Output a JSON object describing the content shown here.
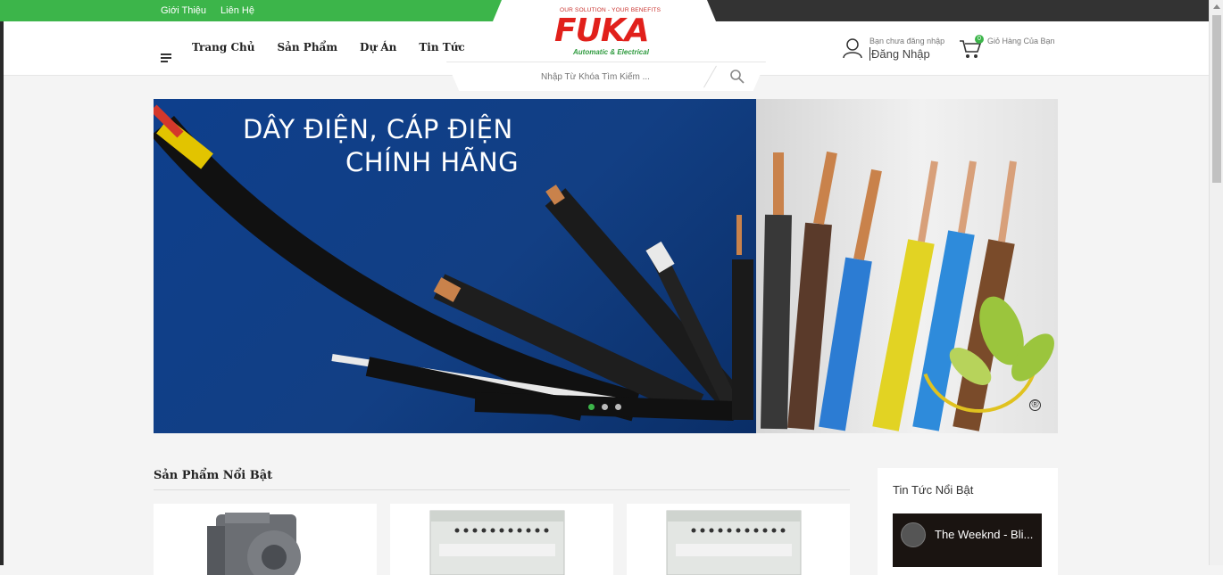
{
  "topbar": {
    "links": [
      "Giới Thiệu",
      "Liên Hệ"
    ]
  },
  "nav": {
    "items": [
      "Trang Chủ",
      "Sản Phẩm",
      "Dự Án",
      "Tin Tức"
    ]
  },
  "logo": {
    "tagline": "OUR SOLUTION - YOUR BENEFITS",
    "word": "FUKA",
    "subtitle": "Automatic & Electrical"
  },
  "search": {
    "placeholder": "Nhập Từ Khóa Tìm Kiếm ..."
  },
  "account": {
    "status": "Bạn chưa đăng nhập",
    "login": "Đăng Nhập"
  },
  "cart": {
    "count": "0",
    "label": "Giỏ Hàng Của Bạn"
  },
  "banner": {
    "line1": "DÂY ĐIỆN, CÁP ĐIỆN",
    "line2": "CHÍNH HÃNG",
    "slides": 3,
    "active_slide": 1,
    "reg_mark": "®"
  },
  "products": {
    "title": "Sản Phẩm Nổi Bật"
  },
  "news": {
    "title": "Tin Tức Nổi Bật",
    "video_title": "The Weeknd - Bli..."
  },
  "colors": {
    "brand_green": "#3cb54a",
    "brand_red": "#e1201b",
    "banner_blue": "#0e3f8c"
  },
  "icons": {
    "menu": "hamburger-icon",
    "search": "search-icon",
    "user": "user-icon",
    "cart": "cart-icon"
  }
}
